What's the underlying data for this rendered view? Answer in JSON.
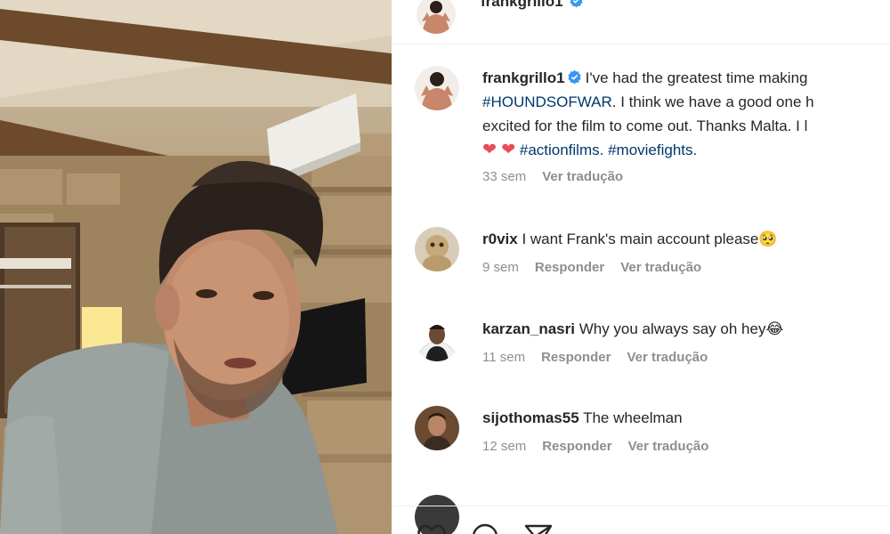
{
  "post": {
    "username": "frankgrillo1",
    "caption_lines": [
      "I've had the greatest time making",
      "#HOUNDSOFWAR",
      ". I think we have a good one h",
      "excited for the film to come out. Thanks Malta. I l"
    ],
    "caption_tags": [
      "#actionfilms.",
      "#moviefights."
    ],
    "caption_hearts": "❤ ❤",
    "time": "33 sem",
    "translate": "Ver tradução"
  },
  "comments": [
    {
      "username": "r0vix",
      "text": "I want Frank's main account please",
      "emoji": "🥺",
      "time": "9 sem",
      "reply": "Responder",
      "translate": "Ver tradução"
    },
    {
      "username": "karzan_nasri",
      "text": "Why you always say oh hey",
      "emoji": "😂",
      "time": "11 sem",
      "reply": "Responder",
      "translate": "Ver tradução"
    },
    {
      "username": "sijothomas55",
      "text": "The wheelman",
      "emoji": "",
      "time": "12 sem",
      "reply": "Responder",
      "translate": "Ver tradução"
    }
  ],
  "icons": [
    "verified-badge-icon",
    "heart-icon",
    "comment-icon",
    "share-icon"
  ],
  "colors": {
    "hashtag": "#00376b",
    "verified": "#3897f0",
    "heart": "#ed4956",
    "muted": "#8e8e8e"
  }
}
